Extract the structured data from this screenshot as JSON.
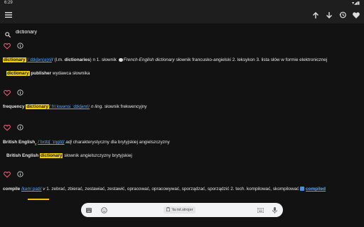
{
  "status_bar": {
    "time": "6:29",
    "right_icons": "▾◢▮"
  },
  "toolbar": {
    "icons": [
      "menu-icon",
      "arrow-up-icon",
      "arrow-down-icon",
      "history-icon",
      "heart-icon"
    ]
  },
  "search": {
    "value": "dictionary",
    "placeholder": ""
  },
  "colors": {
    "highlight": "#f2d000",
    "link": "#5aa9ff",
    "favorite": "#e5566a",
    "background": "#121212"
  },
  "entries": [
    {
      "lines": [
        {
          "headword": "dictionary",
          "pron": "/ˈdɪkʃən(ə)ri/",
          "rest": "/ (l.m. ",
          "plural": "dictionaries",
          "def1": ") n 1. słownik ",
          "french": "French-English dictionary",
          "def2": " słownik francusko-angielski 2. leksykon 3. lista słów w formie elektronicznej"
        },
        {
          "headword": "dictionary",
          "after": "publisher",
          "def": " wydawca słownika"
        }
      ]
    },
    {
      "lines": [
        {
          "pre": "frequency",
          "headword": "dictionary",
          "pron": "/ˈfriːkwənsi ˈdɪkʃənri/",
          "pos": " n ling.",
          "def": " słownik frekwencyjny"
        }
      ]
    },
    {
      "lines": [
        {
          "headword": "British English",
          "sub": "2",
          "pron": "/ˈbrɪtɪʃ ˈɪŋɡlɪʃ/",
          "pos": " adj",
          "def": " charakterystyczny dla brytyjskiej angielszczyzny"
        },
        {
          "pre": "British English",
          "headword": "dictionary",
          "def": " słownik angielszczyzny brytyjskiej"
        }
      ]
    },
    {
      "lines": [
        {
          "headword": "compile",
          "pron": "/kəmˈpaɪl/",
          "pos": " v",
          "def": " 1. zebrać, zbierać, zestawiać, zestawić, opracować, opracowywać, sporządzać, sporządzić 2. tech. kompilować, skompilować ",
          "link": "compiled"
        }
      ]
    }
  ],
  "keyboard": {
    "suggestion": "ˈfaːrst.strojər",
    "icons": [
      "grid-icon",
      "emoji-icon",
      "clipboard-icon",
      "keyboard-icon",
      "mic-icon"
    ]
  }
}
